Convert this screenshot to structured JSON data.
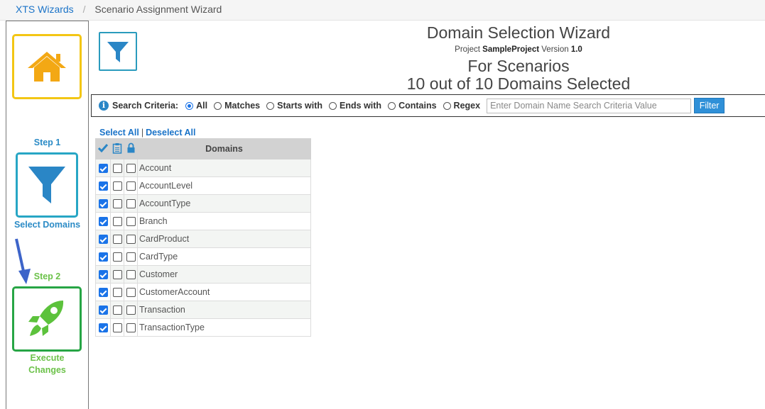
{
  "breadcrumb": {
    "root": "XTS Wizards",
    "current": "Scenario Assignment Wizard"
  },
  "sidebar": {
    "step1_label": "Step 1",
    "step1_caption": "Select Domains",
    "step2_label": "Step 2",
    "step2_caption_line1": "Execute",
    "step2_caption_line2": "Changes"
  },
  "header": {
    "title": "Domain Selection Wizard",
    "project_prefix": "Project",
    "project_name": "SampleProject",
    "version_prefix": "Version",
    "version": "1.0",
    "scope": "For Scenarios",
    "selection_summary": "10 out of 10 Domains Selected"
  },
  "search": {
    "criteria_label": "Search Criteria:",
    "options": [
      "All",
      "Matches",
      "Starts with",
      "Ends with",
      "Contains",
      "Regex"
    ],
    "selected_option": "All",
    "placeholder": "Enter Domain Name Search Criteria Value",
    "value": "",
    "filter_button": "Filter"
  },
  "selection": {
    "select_all": "Select All",
    "separator": "|",
    "deselect_all": "Deselect All"
  },
  "table": {
    "column_header": "Domains",
    "rows": [
      {
        "name": "Account",
        "selected": true,
        "col2": false,
        "locked": false
      },
      {
        "name": "AccountLevel",
        "selected": true,
        "col2": false,
        "locked": false
      },
      {
        "name": "AccountType",
        "selected": true,
        "col2": false,
        "locked": false
      },
      {
        "name": "Branch",
        "selected": true,
        "col2": false,
        "locked": false
      },
      {
        "name": "CardProduct",
        "selected": true,
        "col2": false,
        "locked": false
      },
      {
        "name": "CardType",
        "selected": true,
        "col2": false,
        "locked": false
      },
      {
        "name": "Customer",
        "selected": true,
        "col2": false,
        "locked": false
      },
      {
        "name": "CustomerAccount",
        "selected": true,
        "col2": false,
        "locked": false
      },
      {
        "name": "Transaction",
        "selected": true,
        "col2": false,
        "locked": false
      },
      {
        "name": "TransactionType",
        "selected": true,
        "col2": false,
        "locked": false
      }
    ]
  },
  "colors": {
    "home_tile": "#f3c614",
    "filter_tile": "#27a6c5",
    "execute_tile": "#27a545",
    "accent_blue": "#2b8bc6",
    "step_green": "#6cc24a"
  },
  "icons": {
    "home": "home-icon",
    "filter": "filter-icon",
    "execute": "rocket-icon",
    "info": "info-icon",
    "check_header": "checkmark-icon",
    "clipboard_header": "clipboard-icon",
    "lock_header": "lock-icon"
  }
}
